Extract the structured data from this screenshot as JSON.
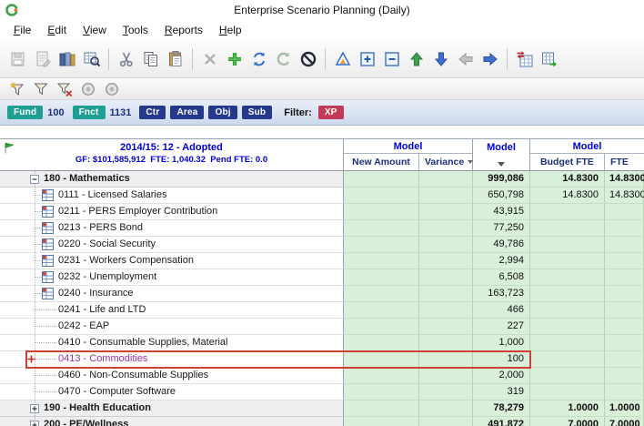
{
  "window": {
    "title": "Enterprise Scenario Planning (Daily)"
  },
  "menu": {
    "items": [
      "File",
      "Edit",
      "View",
      "Tools",
      "Reports",
      "Help"
    ]
  },
  "toolbar": {
    "icons": [
      "save",
      "edit-sheet",
      "ledgers",
      "search-grid",
      "cut",
      "copy",
      "paste",
      "delete",
      "add",
      "refresh",
      "reload",
      "cancel",
      "delta",
      "expand-all",
      "collapse-all",
      "move-up",
      "move-down",
      "back",
      "forward",
      "sync-grid",
      "export-grid"
    ]
  },
  "filter_toolbar": {
    "icons": [
      "new-filter",
      "edit-filter",
      "clear-filter",
      "filter-settings",
      "filter-run"
    ]
  },
  "filterbar": {
    "badges": [
      {
        "label": "Fund",
        "value": "100"
      },
      {
        "label": "Fnct",
        "value": "1131"
      },
      {
        "label": "Ctr",
        "value": ""
      },
      {
        "label": "Area",
        "value": ""
      },
      {
        "label": "Obj",
        "value": ""
      },
      {
        "label": "Sub",
        "value": ""
      }
    ],
    "filter_label": "Filter:",
    "filter_value": "XP"
  },
  "grid": {
    "scenario": {
      "title": "2014/15: 12 - Adopted",
      "subtitle": "GF: $101,585,912  FTE: 1,040.32  Pend FTE: 0.0"
    },
    "column_groups": [
      "Model",
      "Model",
      "Model"
    ],
    "columns": {
      "new_amount": "New Amount",
      "variance": "Variance",
      "budget_fte": "Budget FTE",
      "fte": "FTE"
    },
    "rows": [
      {
        "label": "180 - Mathematics",
        "model": "999,086",
        "budget_fte": "14.8300",
        "fte": "14.8300",
        "type": "group",
        "expanded": true
      },
      {
        "label": "0111 - Licensed Salaries",
        "model": "650,798",
        "budget_fte": "14.8300",
        "fte": "14.8300",
        "icon": "worksheet"
      },
      {
        "label": "0211 - PERS Employer Contribution",
        "model": "43,915",
        "icon": "worksheet"
      },
      {
        "label": "0213 - PERS Bond",
        "model": "77,250",
        "icon": "worksheet"
      },
      {
        "label": "0220 - Social Security",
        "model": "49,786",
        "icon": "worksheet"
      },
      {
        "label": "0231 - Workers Compensation",
        "model": "2,994",
        "icon": "worksheet"
      },
      {
        "label": "0232 - Unemployment",
        "model": "6,508",
        "icon": "worksheet"
      },
      {
        "label": "0240 - Insurance",
        "model": "163,723",
        "icon": "worksheet"
      },
      {
        "label": "0241 - Life and LTD",
        "model": "466"
      },
      {
        "label": "0242 - EAP",
        "model": "227"
      },
      {
        "label": "0410 - Consumable Supplies, Material",
        "model": "1,000"
      },
      {
        "label": "0413 - Commodities",
        "model": "100",
        "highlighted": true
      },
      {
        "label": "0460 - Non-Consumable Supplies",
        "model": "2,000"
      },
      {
        "label": "0470 - Computer Software",
        "model": "319"
      },
      {
        "label": "190 - Health Education",
        "model": "78,279",
        "budget_fte": "1.0000",
        "fte": "1.0000",
        "type": "group",
        "expanded": false
      },
      {
        "label": "200 - PE/Wellness",
        "model": "491,872",
        "budget_fte": "7.0000",
        "fte": "7.0000",
        "type": "group",
        "expanded": false
      }
    ]
  },
  "colors": {
    "header_blue": "#0000dd",
    "subheader_navy": "#1b2f7e",
    "cell_green": "#d9efd9",
    "badge_teal": "#1f9e93",
    "badge_navy": "#24388c",
    "badge_red": "#c23a55",
    "highlight_red": "#cf4034",
    "selected_purple": "#993399"
  }
}
